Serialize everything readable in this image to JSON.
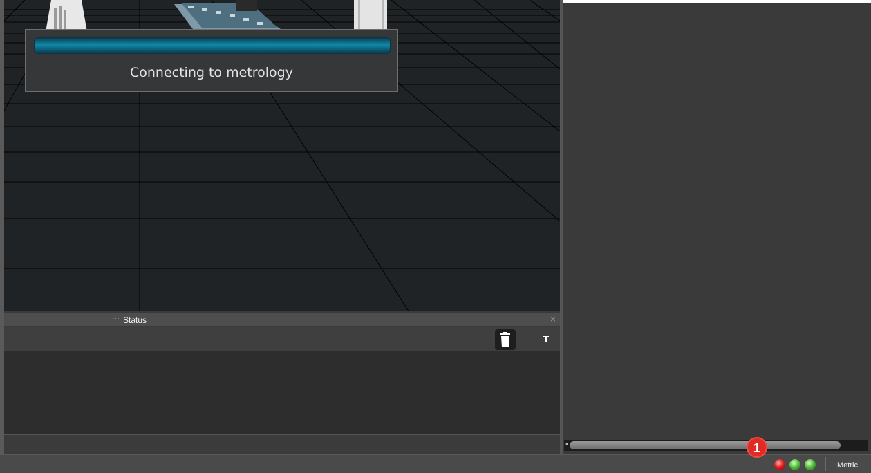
{
  "dialog": {
    "message": "Connecting to metrology",
    "progress_percent": 100
  },
  "status_panel": {
    "title": "Status",
    "close_glyph": "×"
  },
  "statusbar": {
    "indicators": [
      {
        "color": "#e02020",
        "icon": "red-led-icon"
      },
      {
        "color": "#58c040",
        "icon": "green-led-icon"
      },
      {
        "color": "#58c040",
        "icon": "green-led-icon"
      }
    ],
    "units": "Metric",
    "callout_number": "1"
  },
  "colors": {
    "accent": "#1188a8",
    "viewport_bg": "#1f2326",
    "panel_bg": "#3a3a3a",
    "callout": "#e02a24"
  }
}
